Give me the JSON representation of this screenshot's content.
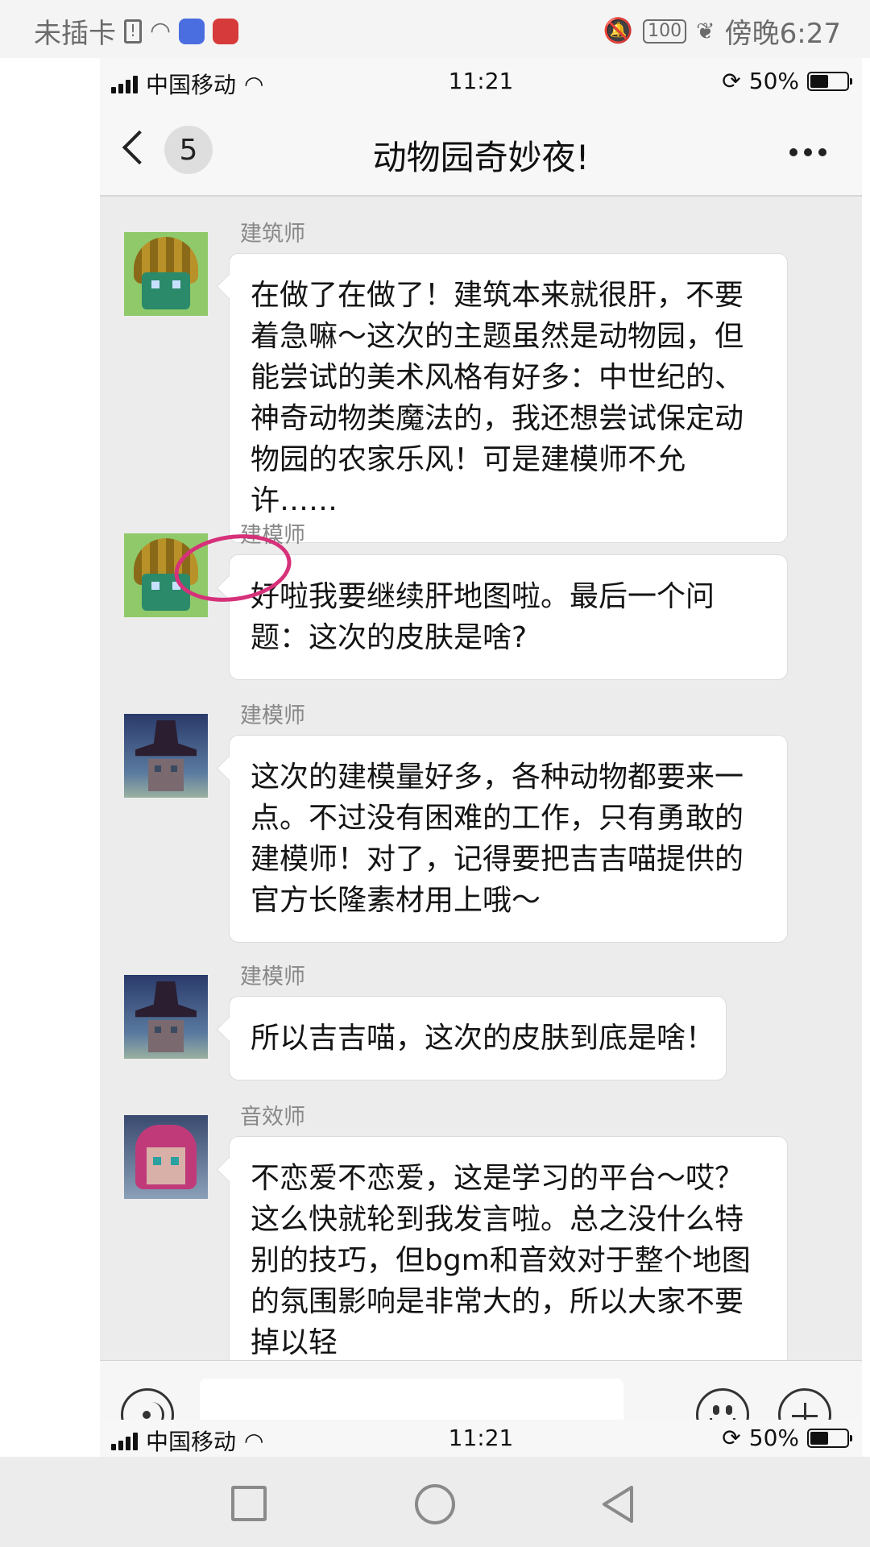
{
  "outer_status": {
    "sim": "未插卡",
    "battery": "100",
    "time": "傍晚6:27"
  },
  "inner_status": {
    "carrier": "中国移动",
    "time": "11:21",
    "battery_pct": "50%"
  },
  "header": {
    "unread_count": "5",
    "title": "动物园奇妙夜!"
  },
  "messages": [
    {
      "sender": "建筑师",
      "avatar": "bee-helmet-avatar",
      "text": "在做了在做了！建筑本来就很肝，不要着急嘛～这次的主题虽然是动物园，但能尝试的美术风格有好多：中世纪的、神奇动物类魔法的，我还想尝试保定动物园的农家乐风！可是建模师不允许……"
    },
    {
      "sender": "建模师",
      "avatar": "bee-helmet-avatar",
      "text": "好啦我要继续肝地图啦。最后一个问题：这次的皮肤是啥?"
    },
    {
      "sender": "建模师",
      "avatar": "witch-hat-avatar",
      "text": "这次的建模量好多，各种动物都要来一点。不过没有困难的工作，只有勇敢的建模师！对了，记得要把吉吉喵提供的官方长隆素材用上哦～"
    },
    {
      "sender": "建模师",
      "avatar": "witch-hat-avatar",
      "text": "所以吉吉喵，这次的皮肤到底是啥！"
    },
    {
      "sender": "音效师",
      "avatar": "pink-hair-avatar",
      "text": "不恋爱不恋爱，这是学习的平台～哎？这么快就轮到我发言啦。总之没什么特别的技巧，但bgm和音效对于整个地图的氛围影响是非常大的，所以大家不要掉以轻"
    }
  ],
  "input": {
    "value": "",
    "placeholder": ""
  },
  "colors": {
    "annotation": "#d6317a",
    "bubble": "#ffffff",
    "chat_bg": "#ececec"
  }
}
